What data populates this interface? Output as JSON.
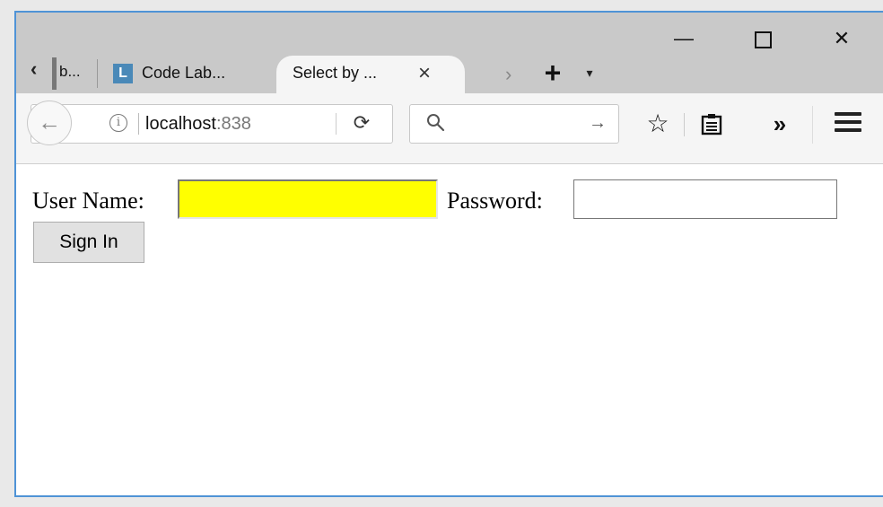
{
  "browser": {
    "tabs": {
      "overflow_left_label": "b...",
      "inactive_tab": {
        "favicon_letter": "L",
        "label": "Code Lab..."
      },
      "active_tab": {
        "label": "Select by ...",
        "close": "×"
      }
    },
    "window_buttons": {
      "minimize": "—",
      "close": "✕"
    },
    "toolbar": {
      "url_host": "localhost",
      "url_port": ":838",
      "reload": "⟳",
      "go_arrow": "→",
      "star": "☆",
      "overflow": "»"
    },
    "icons": {
      "back": "back-arrow-icon",
      "info": "info-icon",
      "search": "search-icon",
      "star": "star-icon",
      "reader": "reader-view-icon",
      "menu": "hamburger-menu-icon"
    }
  },
  "page": {
    "username_label": "User Name:",
    "password_label": "Password:",
    "username_value": "",
    "password_value": "",
    "signin_label": "Sign In"
  },
  "colors": {
    "username_field_bg": "#ffff00",
    "window_border": "#4f93d6"
  }
}
